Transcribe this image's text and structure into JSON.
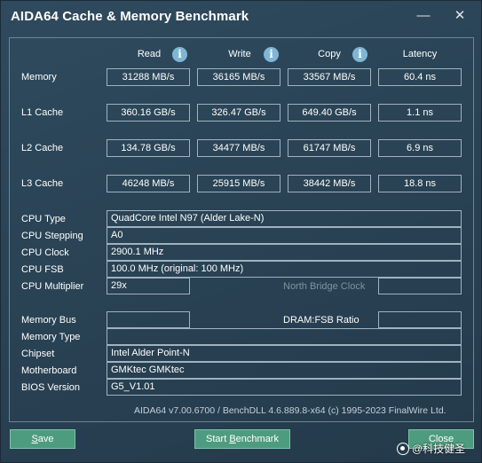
{
  "window": {
    "title": "AIDA64 Cache & Memory Benchmark",
    "minimize_glyph": "—",
    "close_glyph": "✕"
  },
  "columns": {
    "read": "Read",
    "write": "Write",
    "copy": "Copy",
    "latency": "Latency",
    "info_glyph": "i"
  },
  "rows": [
    {
      "label": "Memory",
      "read": "31288 MB/s",
      "write": "36165 MB/s",
      "copy": "33567 MB/s",
      "latency": "60.4 ns"
    },
    {
      "label": "L1 Cache",
      "read": "360.16 GB/s",
      "write": "326.47 GB/s",
      "copy": "649.40 GB/s",
      "latency": "1.1 ns"
    },
    {
      "label": "L2 Cache",
      "read": "134.78 GB/s",
      "write": "34477 MB/s",
      "copy": "61747 MB/s",
      "latency": "6.9 ns"
    },
    {
      "label": "L3 Cache",
      "read": "46248 MB/s",
      "write": "25915 MB/s",
      "copy": "38442 MB/s",
      "latency": "18.8 ns"
    }
  ],
  "cpu": {
    "type_label": "CPU Type",
    "type_value": "QuadCore Intel N97  (Alder Lake-N)",
    "stepping_label": "CPU Stepping",
    "stepping_value": "A0",
    "clock_label": "CPU Clock",
    "clock_value": "2900.1 MHz",
    "fsb_label": "CPU FSB",
    "fsb_value": "100.0 MHz  (original: 100 MHz)",
    "multiplier_label": "CPU Multiplier",
    "multiplier_value": "29x",
    "north_bridge_label": "North Bridge Clock"
  },
  "system": {
    "memory_bus_label": "Memory Bus",
    "memory_bus_value": "",
    "dram_fsb_label": "DRAM:FSB Ratio",
    "dram_fsb_value": "",
    "memory_type_label": "Memory Type",
    "chipset_label": "Chipset",
    "chipset_value": "Intel Alder Point-N",
    "motherboard_label": "Motherboard",
    "motherboard_value": "GMKtec GMKtec",
    "bios_label": "BIOS Version",
    "bios_value": "G5_V1.01"
  },
  "footer": "AIDA64 v7.00.6700 / BenchDLL 4.6.889.8-x64  (c) 1995-2023 FinalWire Ltd.",
  "buttons": {
    "save_accel": "S",
    "save_rest": "ave",
    "start_pre": "Start ",
    "start_accel": "B",
    "start_rest": "enchmark",
    "close_label": "Close"
  },
  "watermark": "@科技健圣",
  "colors": {
    "background": "#2a4456",
    "button": "#4e9c80",
    "info_icon": "#7fb6d6"
  }
}
